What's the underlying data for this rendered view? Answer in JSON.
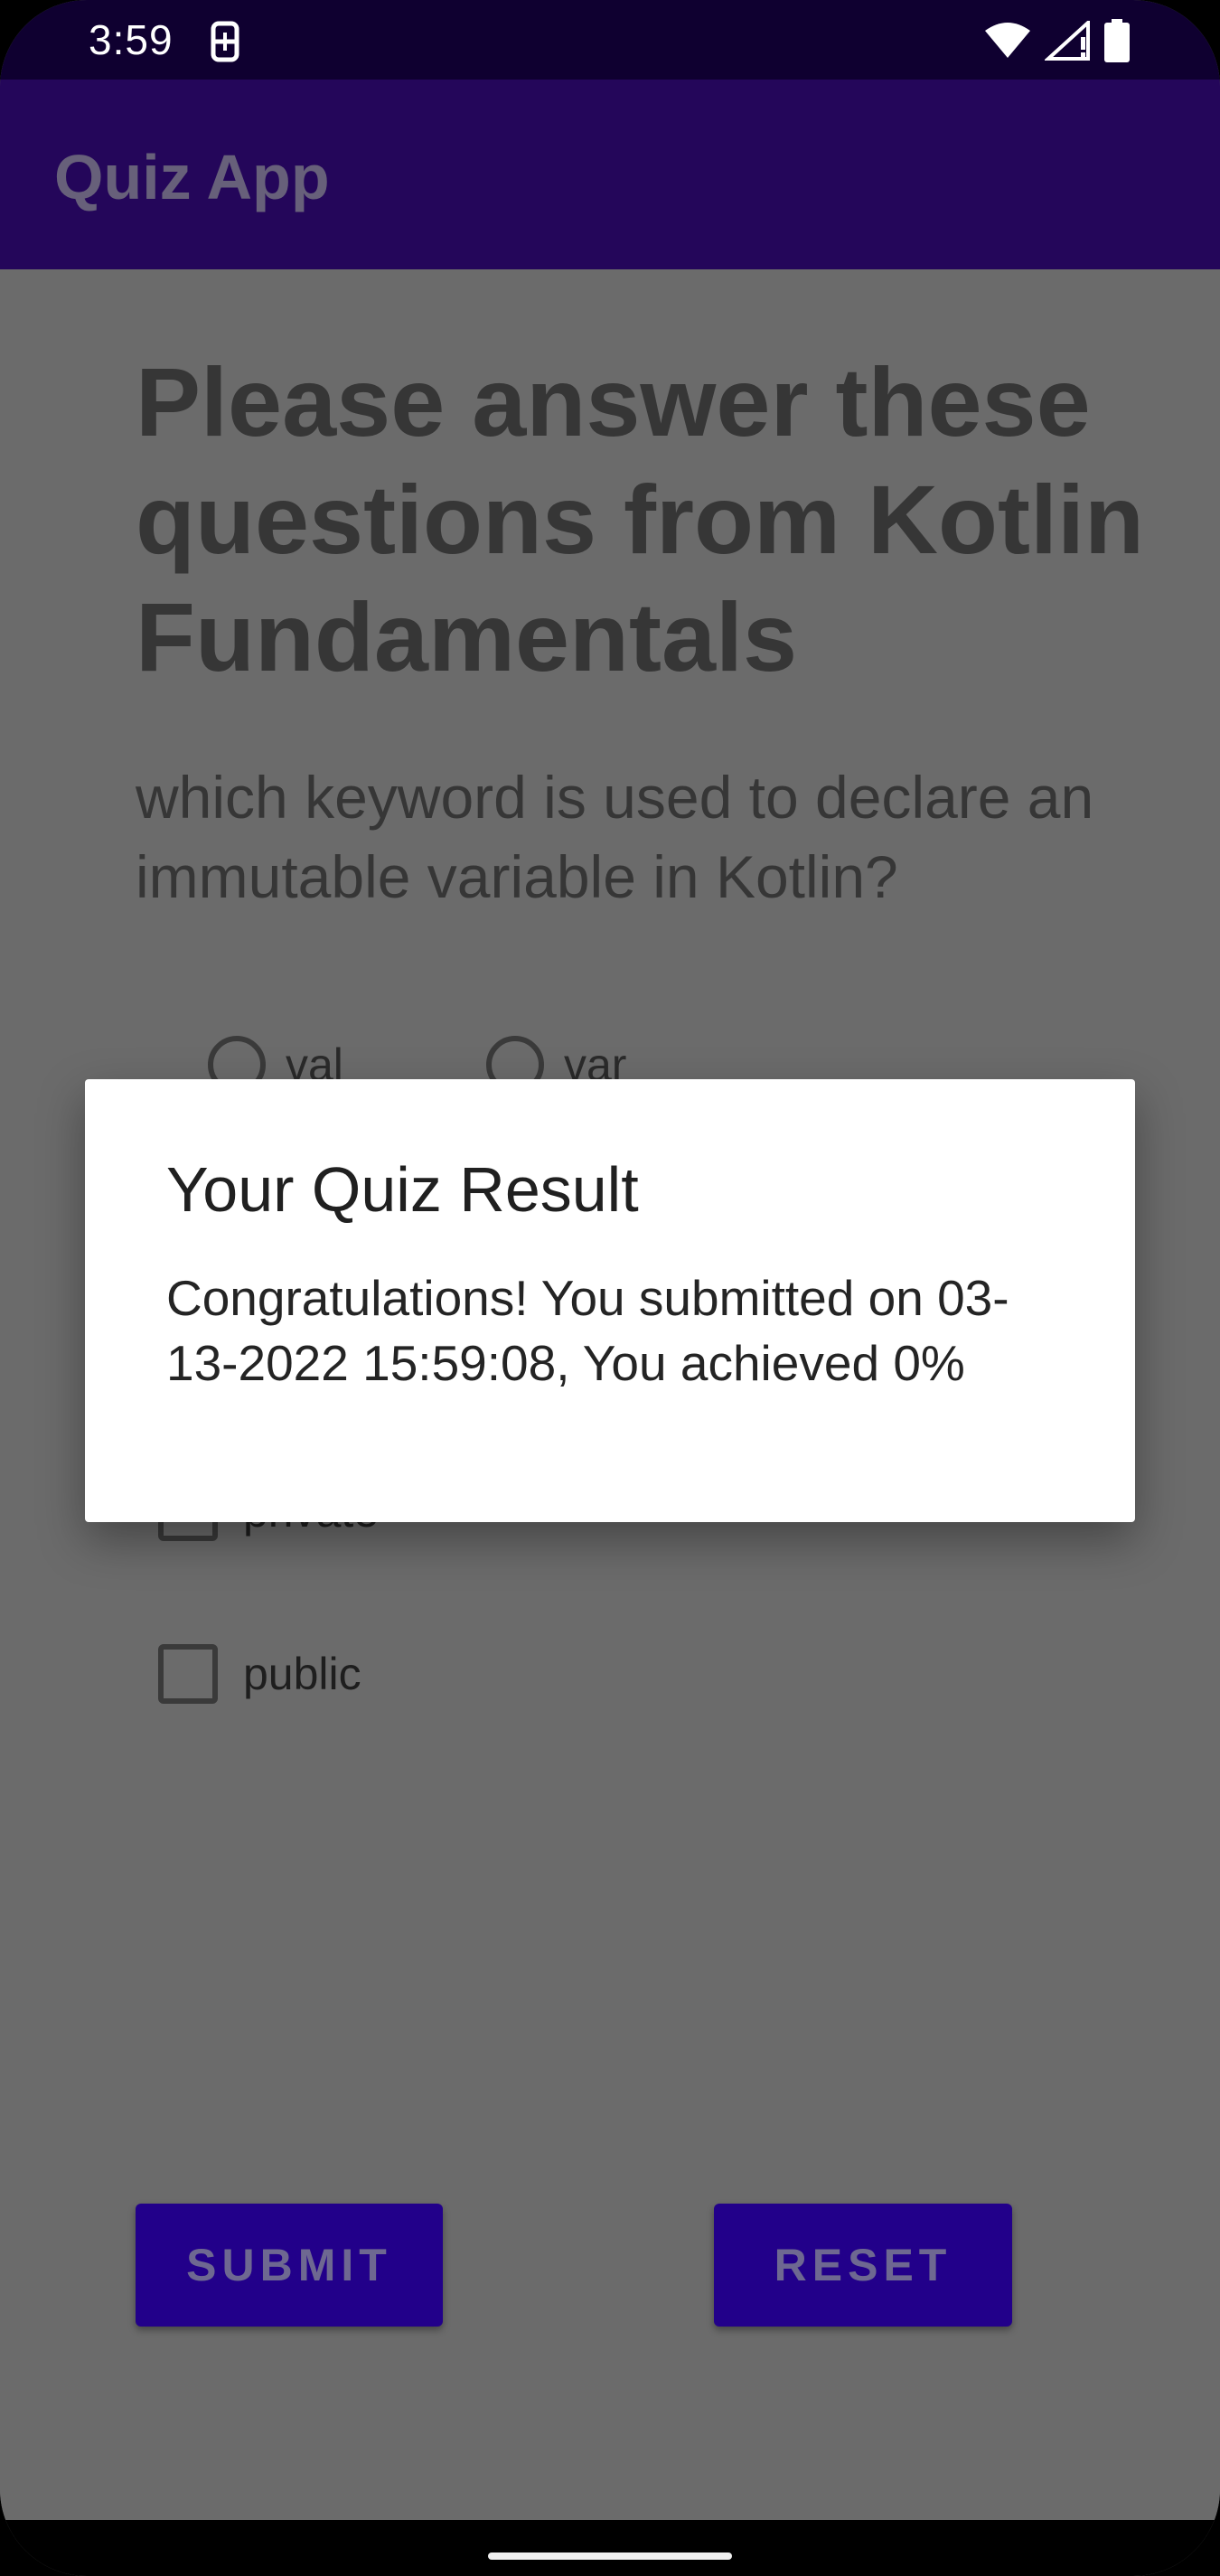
{
  "status_bar": {
    "time": "3:59",
    "icons": [
      "notification-icon",
      "wifi-icon",
      "signal-icon",
      "battery-icon"
    ]
  },
  "app_bar": {
    "title": "Quiz App"
  },
  "quiz": {
    "heading": "Please answer these questions from Kotlin Fundamentals",
    "question": "which keyword is used to declare an immutable variable in Kotlin?",
    "radio_options": [
      {
        "label": "val"
      },
      {
        "label": "var"
      }
    ],
    "checkbox_options": [
      {
        "label": "private"
      },
      {
        "label": "public"
      }
    ]
  },
  "buttons": {
    "submit_label": "SUBMIT",
    "reset_label": "RESET"
  },
  "dialog": {
    "title": "Your Quiz Result",
    "message": "Congratulations! You submitted on 03-13-2022 15:59:08, You achieved 0%"
  },
  "colors": {
    "app_bar": "#24065a",
    "status_bar": "#0f0030",
    "button": "#22008a",
    "scrim": "#6b6b6b"
  }
}
